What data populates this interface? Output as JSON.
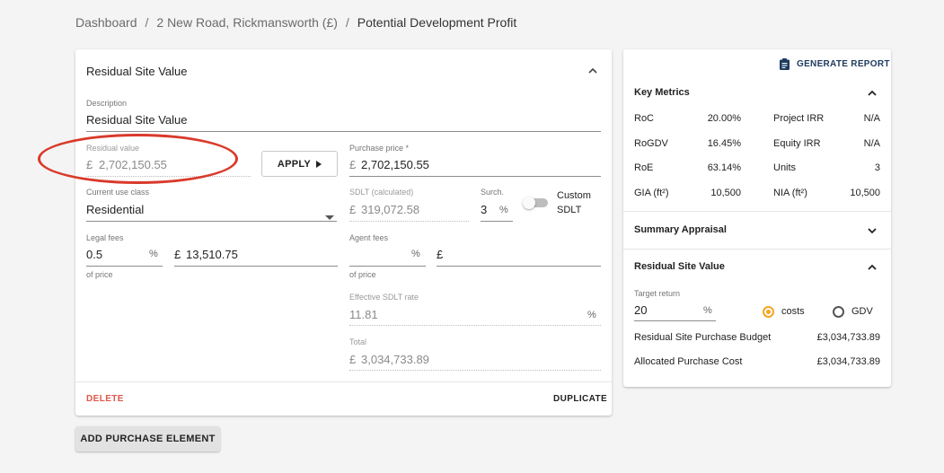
{
  "breadcrumb": {
    "items": [
      "Dashboard",
      "2 New Road, Rickmansworth (£)",
      "Potential Development Profit"
    ],
    "separator": "/"
  },
  "left_card": {
    "title": "Residual Site Value",
    "description": {
      "label": "Description",
      "value": "Residual Site Value"
    },
    "residual_value": {
      "label": "Residual value",
      "currency": "£",
      "value": "2,702,150.55"
    },
    "apply_label": "APPLY",
    "purchase_price": {
      "label": "Purchase price *",
      "currency": "£",
      "value": "2,702,150.55"
    },
    "current_use_class": {
      "label": "Current use class",
      "value": "Residential"
    },
    "sdlt": {
      "label": "SDLT (calculated)",
      "currency": "£",
      "value": "319,072.58"
    },
    "surch": {
      "label": "Surch.",
      "value": "3",
      "unit": "%"
    },
    "custom_sdlt": {
      "label_line1": "Custom",
      "label_line2": "SDLT"
    },
    "legal_fees": {
      "label": "Legal fees",
      "percent": "0.5",
      "unit": "%",
      "currency": "£",
      "amount": "13,510.75",
      "helper": "of price"
    },
    "agent_fees": {
      "label": "Agent fees",
      "percent": "",
      "unit": "%",
      "currency": "£",
      "amount": "",
      "helper": "of price"
    },
    "effective_sdlt": {
      "label": "Effective SDLT rate",
      "value": "11.81",
      "unit": "%"
    },
    "total": {
      "label": "Total",
      "currency": "£",
      "value": "3,034,733.89"
    },
    "delete_label": "DELETE",
    "duplicate_label": "DUPLICATE"
  },
  "add_purchase_label": "ADD PURCHASE ELEMENT",
  "right_card": {
    "generate_report_label": "GENERATE REPORT",
    "key_metrics": {
      "title": "Key Metrics",
      "rows": [
        {
          "l1": "RoC",
          "v1": "20.00%",
          "l2": "Project IRR",
          "v2": "N/A"
        },
        {
          "l1": "RoGDV",
          "v1": "16.45%",
          "l2": "Equity IRR",
          "v2": "N/A"
        },
        {
          "l1": "RoE",
          "v1": "63.14%",
          "l2": "Units",
          "v2": "3"
        },
        {
          "l1": "GIA (ft²)",
          "v1": "10,500",
          "l2": "NIA (ft²)",
          "v2": "10,500"
        }
      ]
    },
    "summary_appraisal_title": "Summary Appraisal",
    "rsv": {
      "title": "Residual Site Value",
      "target_return": {
        "label": "Target return",
        "value": "20",
        "unit": "%"
      },
      "radio_costs": "costs",
      "radio_gdv": "GDV",
      "budget_label": "Residual Site Purchase Budget",
      "budget_value": "£3,034,733.89",
      "allocated_label": "Allocated Purchase Cost",
      "allocated_value": "£3,034,733.89"
    }
  },
  "colors": {
    "delete": "#e0574a",
    "highlight": "#d93a2b",
    "radio_active": "#f5a623",
    "report": "#1e3a5f"
  }
}
